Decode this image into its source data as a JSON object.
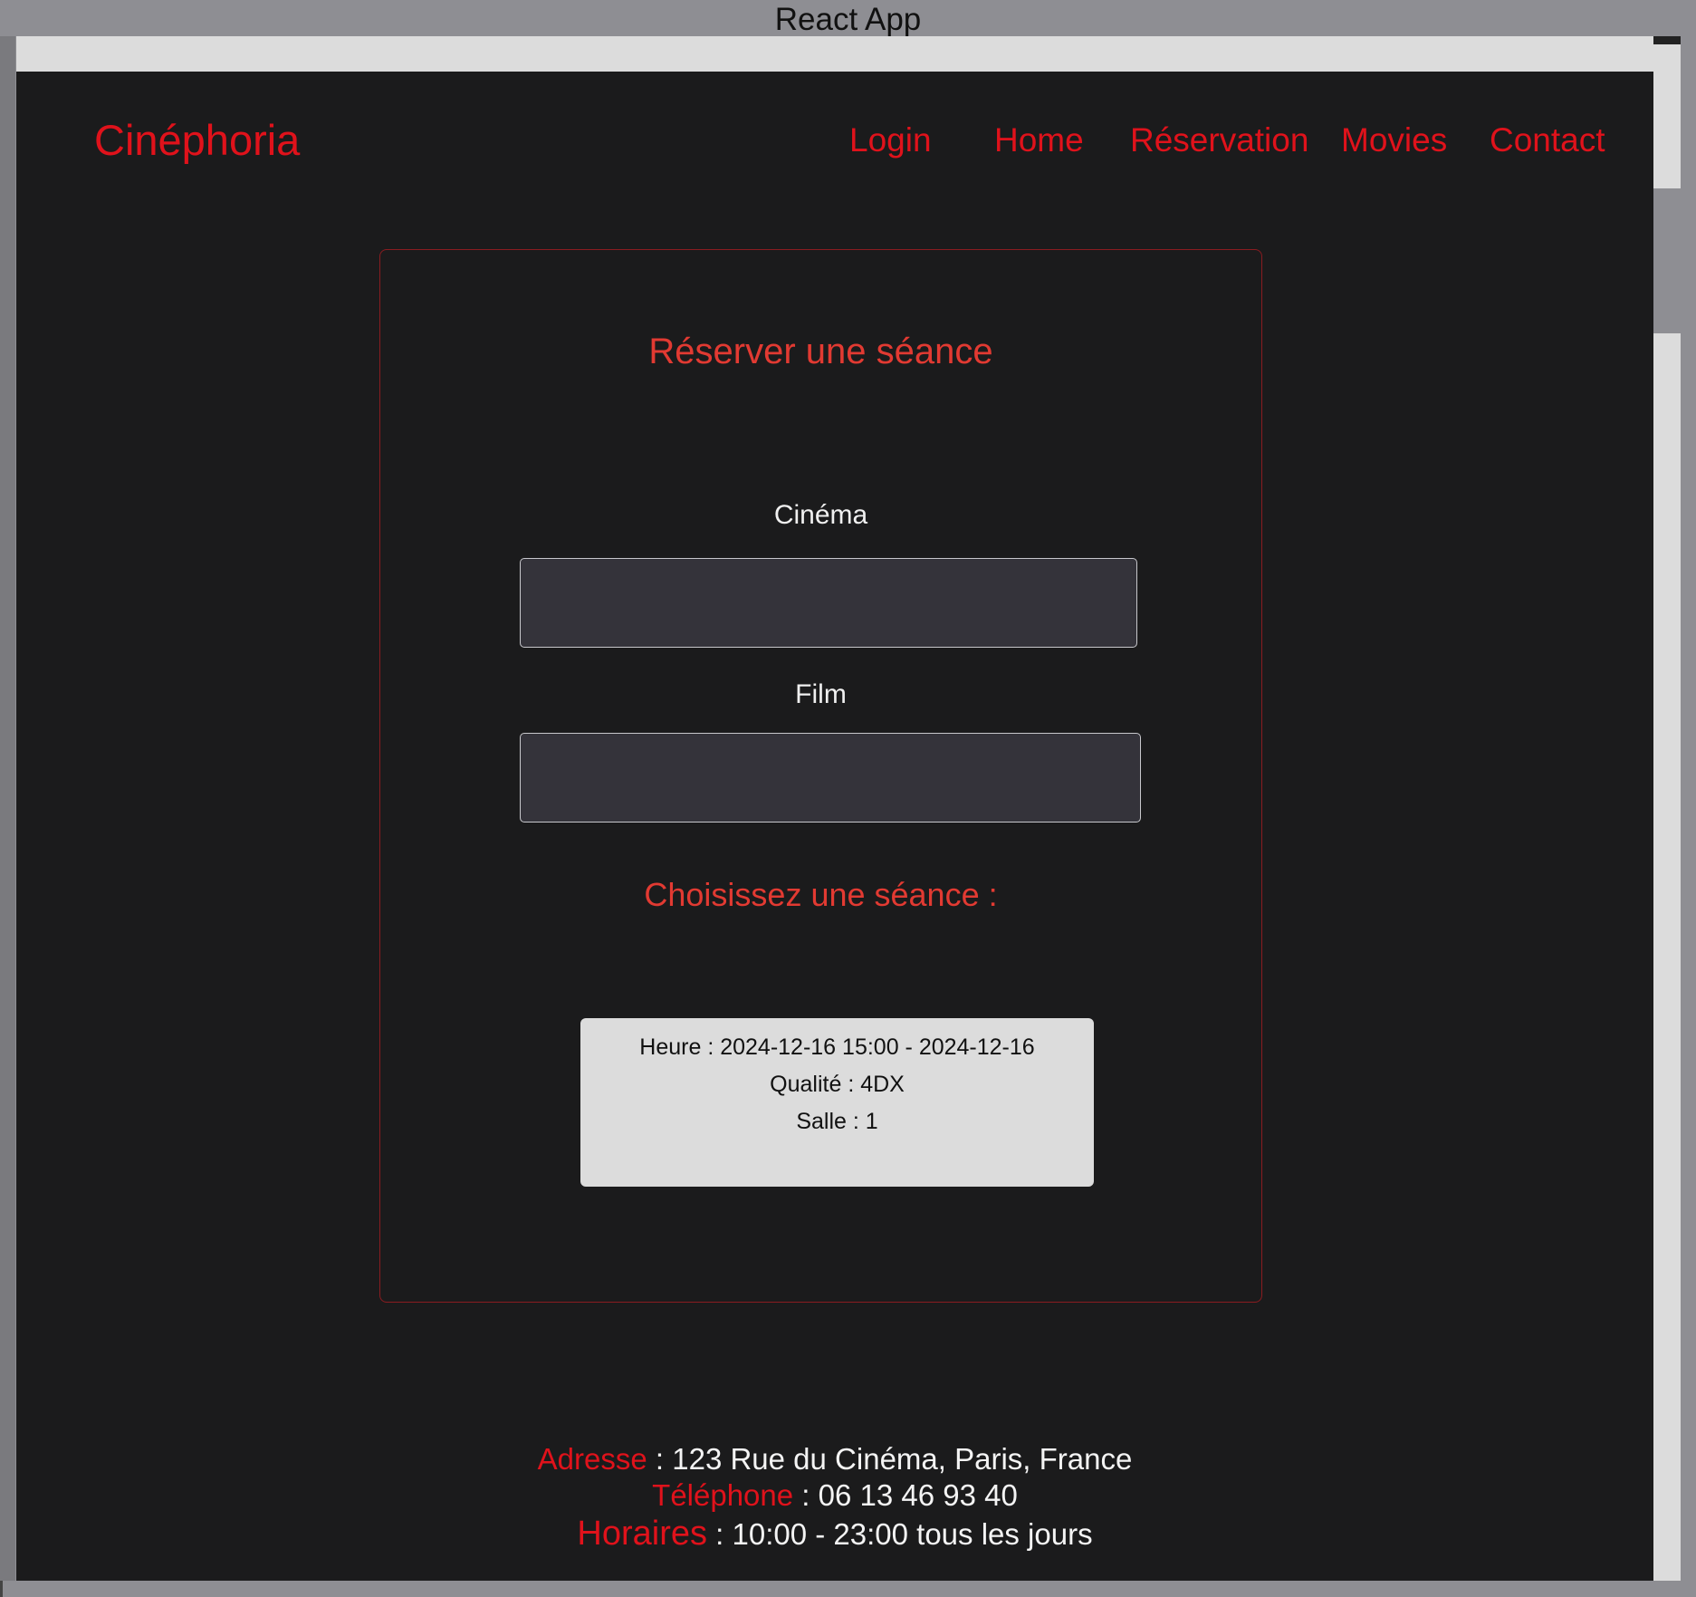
{
  "window": {
    "title": "React App"
  },
  "header": {
    "brand": "Cinéphoria",
    "nav": {
      "login": "Login",
      "home": "Home",
      "reservation": "Réservation",
      "movies": "Movies",
      "contact": "Contact"
    }
  },
  "booking": {
    "title": "Réserver une séance",
    "cinema_label": "Cinéma",
    "cinema_value": "",
    "film_label": "Film",
    "film_value": "",
    "sessions_title": "Choisissez une séance :",
    "sessions": [
      {
        "heure": "Heure : 2024-12-16 15:00 - 2024-12-16",
        "qualite": "Qualité : 4DX",
        "salle": "Salle : 1"
      }
    ]
  },
  "footer": {
    "address_key": "Adresse",
    "address_value": " : 123 Rue du Cinéma, Paris, France",
    "phone_key": "Téléphone",
    "phone_value": " : 06 13 46 93 40",
    "hours_key": "Horaires",
    "hours_value": " : 10:00 - 23:00 tous les jours"
  },
  "colors": {
    "background": "#1b1b1c",
    "accent": "#e0121b",
    "card_border": "#8a1c20",
    "input_bg": "#34333a",
    "session_bg": "#dcdcdc"
  }
}
